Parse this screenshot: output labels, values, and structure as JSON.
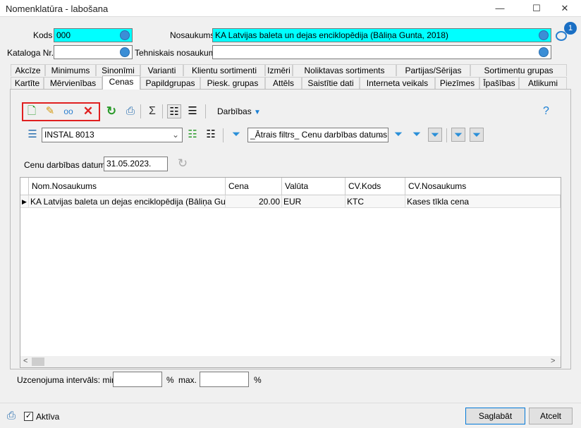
{
  "window": {
    "title": "Nomenklatūra - labošana",
    "minimize": "—",
    "maximize": "☐",
    "close": "✕"
  },
  "fields": {
    "kods_label": "Kods",
    "kods_value": "000",
    "nosaukums_label": "Nosaukums",
    "nosaukums_value": "KA Latvijas baleta un dejas enciklopēdija (Bāliņa Gunta, 2018)",
    "kataloga_label": "Kataloga Nr.",
    "kataloga_value": "",
    "tehn_label": "Tehniskais nosaukums",
    "tehn_value": ""
  },
  "comments_badge": "1",
  "tabs_row1": [
    "Akcīze",
    "Minimums",
    "Sinonīmi",
    "Varianti",
    "Klientu sortimenti",
    "Izmēri",
    "Noliktavas sortiments",
    "Partijas/Sērijas",
    "Sortimentu grupas"
  ],
  "tabs_row2": [
    "Kartīte",
    "Mērvienības",
    "Cenas",
    "Papildgrupas",
    "Piesk. grupas",
    "Attēls",
    "Saistītie dati",
    "Interneta veikals",
    "Piezīmes",
    "Īpašības",
    "Atlikumi"
  ],
  "toolbar": {
    "actions_label": "Darbības",
    "help": "?"
  },
  "toolbar2": {
    "layout_value": "INSTAL 8013",
    "filter_value": "_Ātrais filtrs_ Cenu darbības datums"
  },
  "date": {
    "label": "Cenu darbības datums",
    "value": "31.05.2023."
  },
  "grid": {
    "columns": [
      "Nom.Nosaukums",
      "Cena",
      "Valūta",
      "CV.Kods",
      "CV.Nosaukums"
    ],
    "rows": [
      [
        "KA Latvijas baleta un dejas enciklopēdija (Bāliņa Gunta...",
        "20.00",
        "EUR",
        "KTC",
        "Kases tīkla cena"
      ]
    ]
  },
  "markup": {
    "label": "Uzcenojuma intervāls: min.",
    "pct1": "%",
    "max_label": "max.",
    "pct2": "%",
    "min_value": "",
    "max_value": ""
  },
  "footer": {
    "active_label": "Aktīva",
    "active_checked": true,
    "save": "Saglabāt",
    "cancel": "Atcelt"
  },
  "colors": {
    "required": "#00ffff",
    "highlight": "#e02020",
    "accent": "#1a7fd4"
  }
}
